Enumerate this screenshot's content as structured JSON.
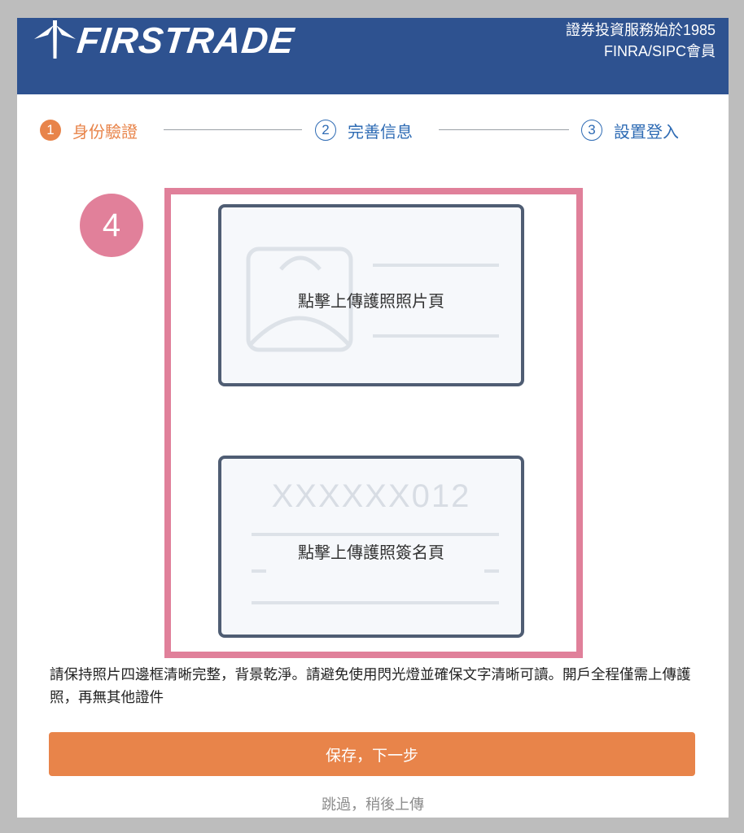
{
  "header": {
    "logo_text": "FIRSTRADE",
    "tagline_line1": "證券投資服務始於1985",
    "tagline_line2": "FINRA/SIPC會員"
  },
  "steps": [
    {
      "number": "1",
      "label": "身份驗證",
      "state": "active"
    },
    {
      "number": "2",
      "label": "完善信息",
      "state": "pending"
    },
    {
      "number": "3",
      "label": "設置登入",
      "state": "pending"
    }
  ],
  "annotation_badge": "4",
  "upload": {
    "photo_page_label": "點擊上傳護照照片頁",
    "signature_page_label": "點擊上傳護照簽名頁",
    "signature_page_number": "XXXXXX012"
  },
  "instruction": "請保持照片四邊框清晰完整，背景乾淨。請避免使用閃光燈並確保文字清晰可讀。開戶全程僅需上傳護照，再無其他證件",
  "buttons": {
    "primary": "保存，下一步",
    "skip": "跳過，稍後上傳"
  },
  "colors": {
    "header_bg": "#2e5290",
    "accent_orange": "#e8844a",
    "step_blue": "#2e6bb4",
    "highlight_pink": "#e0809a"
  }
}
